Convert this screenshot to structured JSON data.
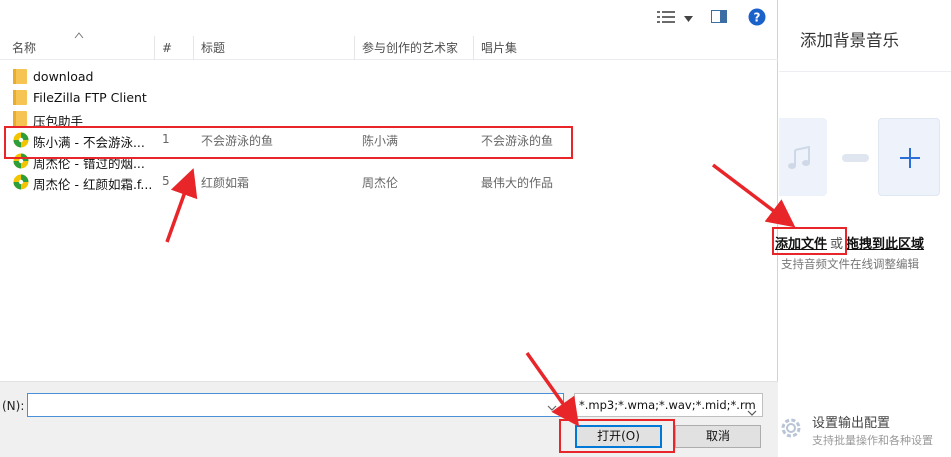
{
  "dialog": {
    "columns": {
      "name": "名称",
      "num": "#",
      "title": "标题",
      "artist": "参与创作的艺术家",
      "album": "唱片集"
    },
    "files": [
      {
        "name": "download",
        "type": "folder"
      },
      {
        "name": "FileZilla FTP Client",
        "type": "folder"
      },
      {
        "name": "压包助手",
        "type": "folder"
      },
      {
        "name": "陈小满 - 不会游泳...",
        "type": "audio",
        "num": "1",
        "title": "不会游泳的鱼",
        "artist": "陈小满",
        "album": "不会游泳的鱼"
      },
      {
        "name": "周杰伦 - 错过的烟...",
        "type": "audio",
        "num": "",
        "title": "",
        "artist": "",
        "album": ""
      },
      {
        "name": "周杰伦 - 红颜如霜.f...",
        "type": "audio",
        "num": "5",
        "title": "红颜如霜",
        "artist": "周杰伦",
        "album": "最伟大的作品"
      }
    ],
    "filename_label": "(N):",
    "filename_value": "",
    "file_filter": "*.mp3;*.wma;*.wav;*.mid;*.rm",
    "open_label": "打开(O)",
    "cancel_label": "取消"
  },
  "panel": {
    "title": "添加背景音乐",
    "add_file": "添加文件",
    "or": "或",
    "drag_here": "拖拽到此区域",
    "hint": "支持音频文件在线调整编辑",
    "output_title": "设置输出配置",
    "output_sub": "支持批量操作和各种设置"
  },
  "colors": {
    "highlight_red": "#e8262a",
    "accent_blue": "#0078d7",
    "folder_yellow": "#f6c453"
  }
}
